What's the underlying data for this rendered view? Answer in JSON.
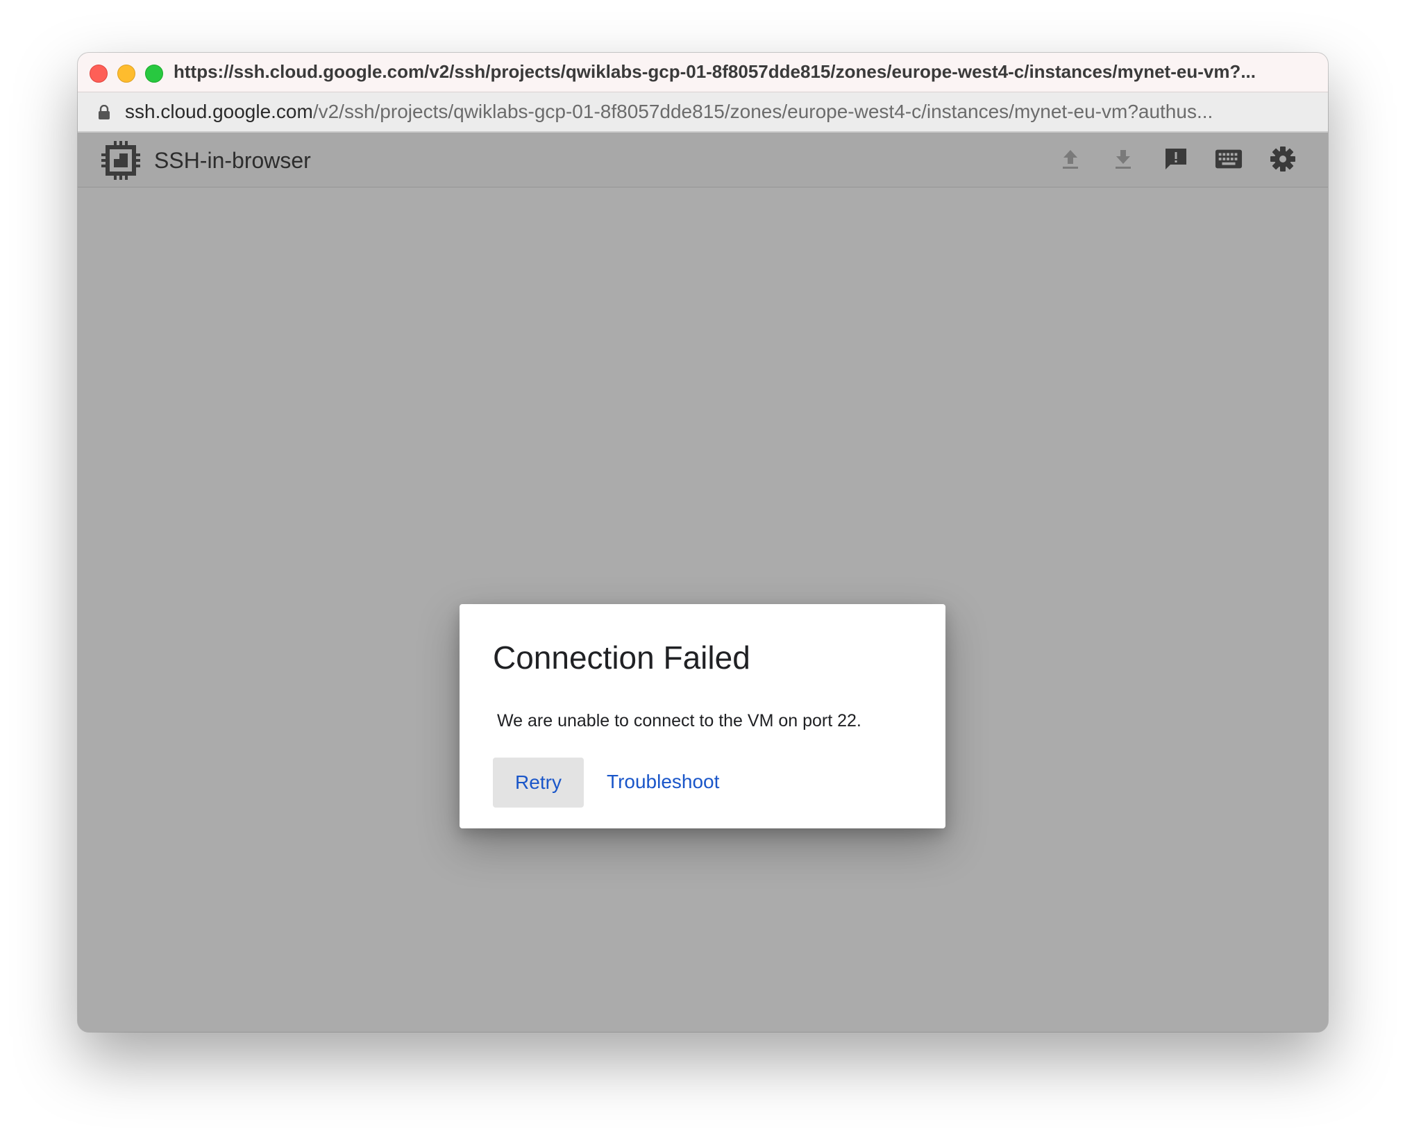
{
  "window": {
    "title": "https://ssh.cloud.google.com/v2/ssh/projects/qwiklabs-gcp-01-8f8057dde815/zones/europe-west4-c/instances/mynet-eu-vm?..."
  },
  "address_bar": {
    "host": "ssh.cloud.google.com",
    "path": "/v2/ssh/projects/qwiklabs-gcp-01-8f8057dde815/zones/europe-west4-c/instances/mynet-eu-vm?authus..."
  },
  "app": {
    "title": "SSH-in-browser",
    "logo_icon": "chip-icon",
    "toolbar": [
      {
        "icon": "upload-icon"
      },
      {
        "icon": "download-icon"
      },
      {
        "icon": "feedback-icon"
      },
      {
        "icon": "keyboard-icon"
      },
      {
        "icon": "gear-icon"
      }
    ]
  },
  "dialog": {
    "title": "Connection Failed",
    "message": "We are unable to connect to the VM on port 22.",
    "retry_label": "Retry",
    "troubleshoot_label": "Troubleshoot"
  },
  "colors": {
    "accent": "#1a56c9",
    "backdrop": "#ababab",
    "traffic_red": "#fe5f57",
    "traffic_yellow": "#febc2e",
    "traffic_green": "#28c840"
  }
}
